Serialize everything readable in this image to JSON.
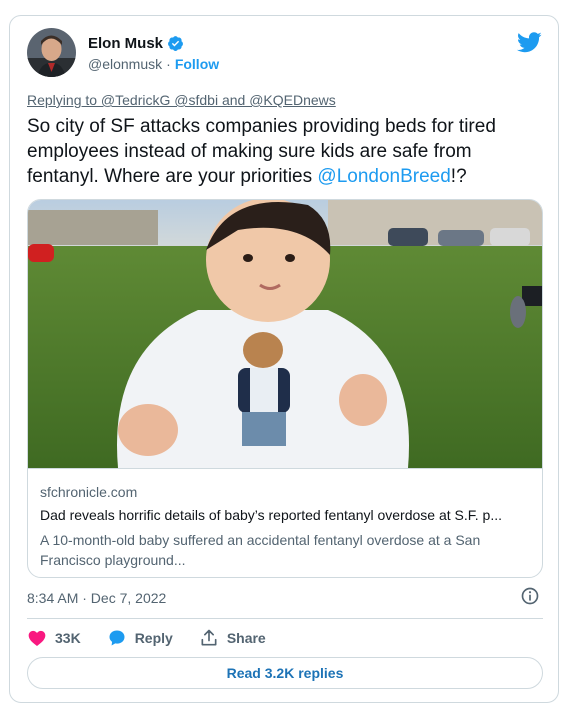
{
  "author": {
    "name": "Elon Musk",
    "handle": "@elonmusk",
    "separator": "·",
    "follow_label": "Follow",
    "verified": true
  },
  "reply_context": "Replying to @TedrickG @sfdbi and @KQEDnews",
  "tweet": {
    "text_before": "So city of SF attacks companies providing beds for tired employees instead of making sure kids are safe from fentanyl. Where are your priorities ",
    "mention": "@LondonBreed",
    "text_after": "!?"
  },
  "link_card": {
    "domain": "sfchronicle.com",
    "title": "Dad reveals horrific details of baby’s reported fentanyl overdose at S.F. p...",
    "description": "A 10-month-old baby suffered an accidental fentanyl overdose at a San Francisco playground..."
  },
  "timestamp": "8:34 AM · Dec 7, 2022",
  "actions": {
    "likes": "33K",
    "reply_label": "Reply",
    "share_label": "Share"
  },
  "read_replies_label": "Read 3.2K replies",
  "colors": {
    "accent": "#1d9bf0",
    "like": "#f91880",
    "text": "#0f1419",
    "muted": "#536471",
    "border": "#cfd9de"
  },
  "icons": [
    "verified-badge-icon",
    "twitter-bird-icon",
    "info-icon",
    "heart-icon",
    "reply-bubble-icon",
    "share-icon"
  ]
}
